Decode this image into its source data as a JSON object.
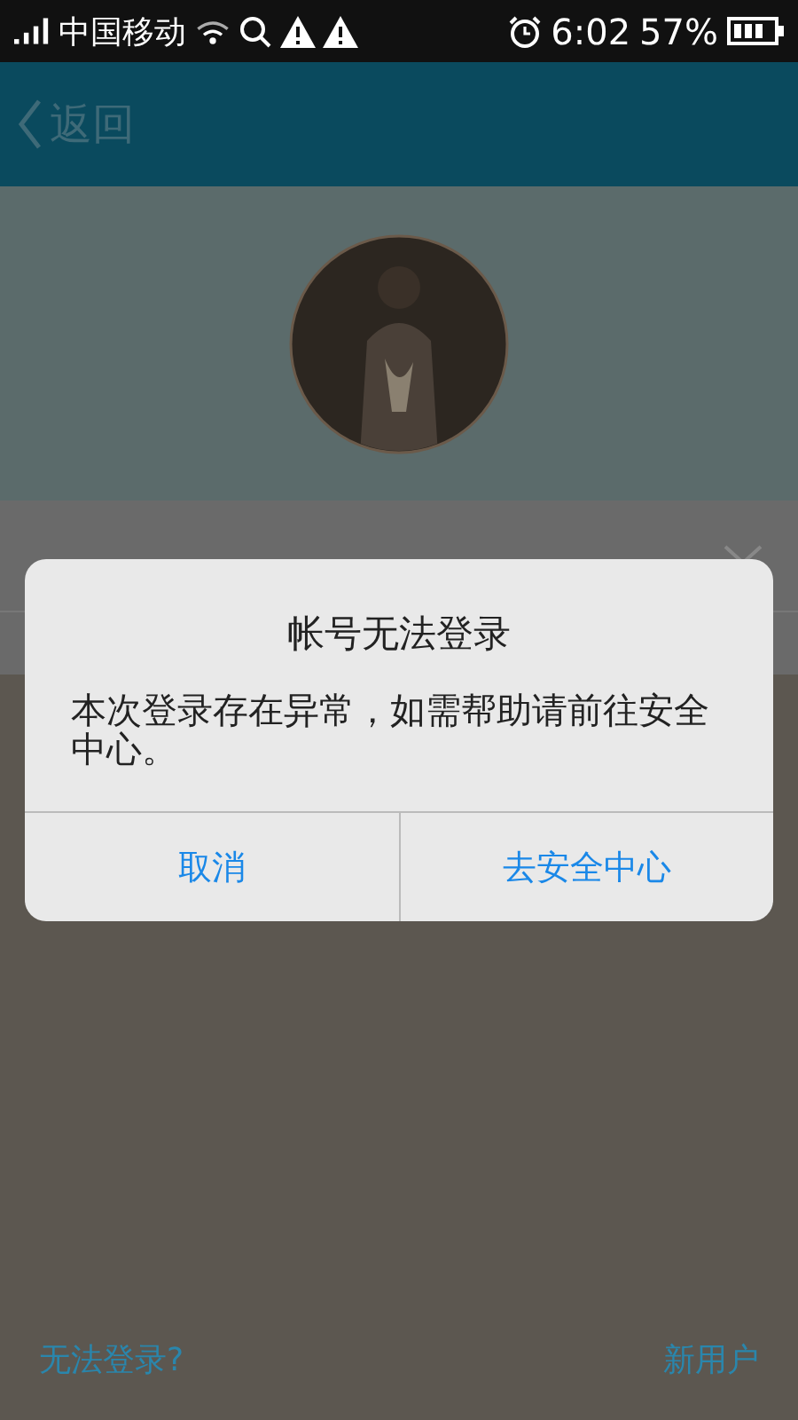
{
  "status_bar": {
    "carrier": "中国移动",
    "time": "6:02",
    "battery": "57%"
  },
  "header": {
    "back": "返回"
  },
  "dialog": {
    "title": "帐号无法登录",
    "message": "本次登录存在异常，如需帮助请前往安全中心。",
    "buttons": [
      "取消",
      "去安全中心"
    ]
  },
  "footer": {
    "links": [
      "无法登录?",
      "新用户"
    ]
  }
}
